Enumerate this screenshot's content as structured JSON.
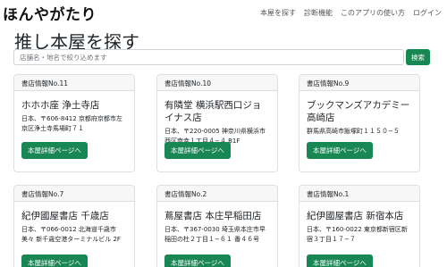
{
  "brand": "ほんやがたり",
  "nav": [
    "本屋を探す",
    "診断機能",
    "このアプリの使い方",
    "ログイン"
  ],
  "page_title": "推し本屋を探す",
  "search": {
    "placeholder": "店舗名・地名で絞り込めます",
    "button_label": "検索"
  },
  "detail_label": "本屋詳細ページへ",
  "cards": [
    {
      "header": "書店情報No.11",
      "title": "ホホホ座 浄土寺店",
      "address": "日本、〒606-8412 京都府京都市左京区浄土寺馬場町７１"
    },
    {
      "header": "書店情報No.10",
      "title": "有隣堂 横浜駅西口ジョイナス店",
      "address": "日本、〒220-0005 神奈川県横浜市西区南幸１丁目４−４ B1F"
    },
    {
      "header": "書店情報No.9",
      "title": "ブックマンズアカデミー高崎店",
      "address": "群馬県高崎市飯塚町１１５０−５"
    },
    {
      "header": "書店情報No.7",
      "title": "紀伊國屋書店 千歳店",
      "address": "日本、〒066-0012 北海道千歳市美々 新千歳空港ターミナルビル 2F"
    },
    {
      "header": "書店情報No.2",
      "title": "蔦屋書店 本庄早稲田店",
      "address": "日本、〒367-0030 埼玉県本庄市早稲田の杜２丁目１−６１ 番４６号"
    },
    {
      "header": "書店情報No.1",
      "title": "紀伊國屋書店 新宿本店",
      "address": "日本、〒160-0022 東京都新宿区新宿３丁目１７−７"
    }
  ]
}
